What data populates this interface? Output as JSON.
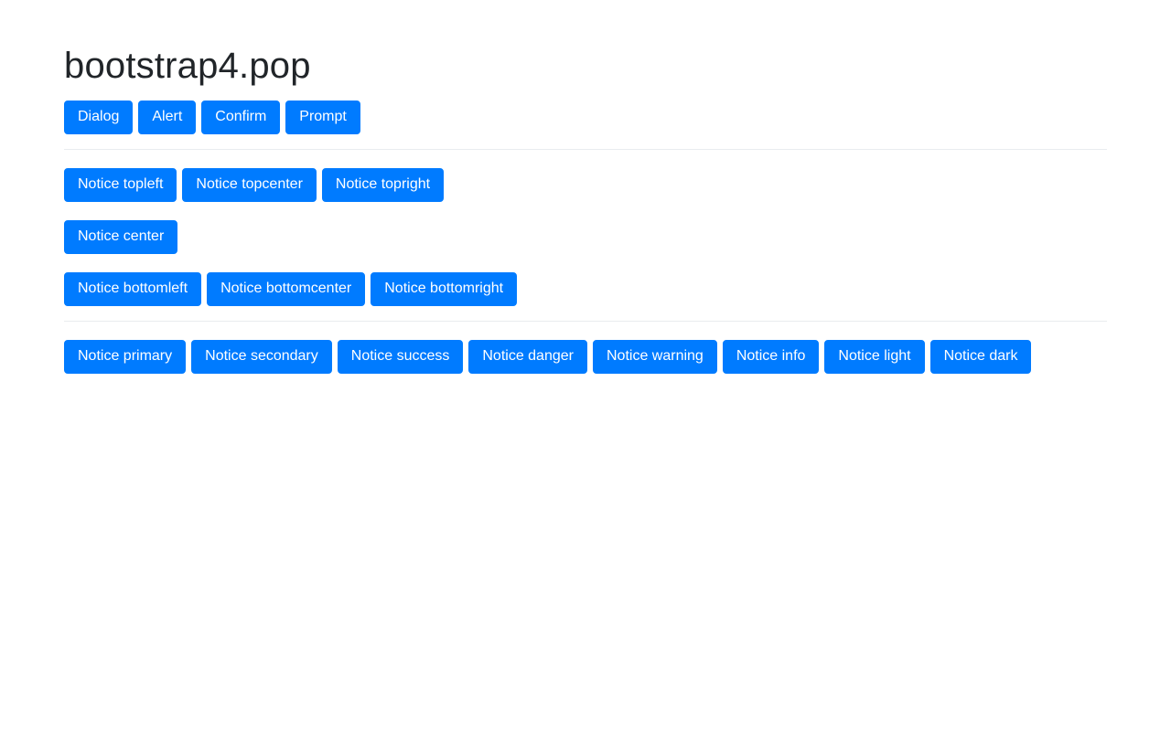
{
  "page": {
    "title": "bootstrap4.pop",
    "background_color": "#ffffff",
    "text_color": "#212529",
    "accent_color": "#007bff",
    "divider_color": "#e9ecef",
    "button_text_color": "#ffffff"
  },
  "dialog_buttons": [
    {
      "label": "Dialog"
    },
    {
      "label": "Alert"
    },
    {
      "label": "Confirm"
    },
    {
      "label": "Prompt"
    }
  ],
  "notice_position_rows": [
    {
      "buttons": [
        {
          "label": "Notice topleft"
        },
        {
          "label": "Notice topcenter"
        },
        {
          "label": "Notice topright"
        }
      ]
    },
    {
      "buttons": [
        {
          "label": "Notice center"
        }
      ]
    },
    {
      "buttons": [
        {
          "label": "Notice bottomleft"
        },
        {
          "label": "Notice bottomcenter"
        },
        {
          "label": "Notice bottomright"
        }
      ]
    }
  ],
  "notice_variant_buttons": [
    {
      "label": "Notice primary"
    },
    {
      "label": "Notice secondary"
    },
    {
      "label": "Notice success"
    },
    {
      "label": "Notice danger"
    },
    {
      "label": "Notice warning"
    },
    {
      "label": "Notice info"
    },
    {
      "label": "Notice light"
    },
    {
      "label": "Notice dark"
    }
  ]
}
